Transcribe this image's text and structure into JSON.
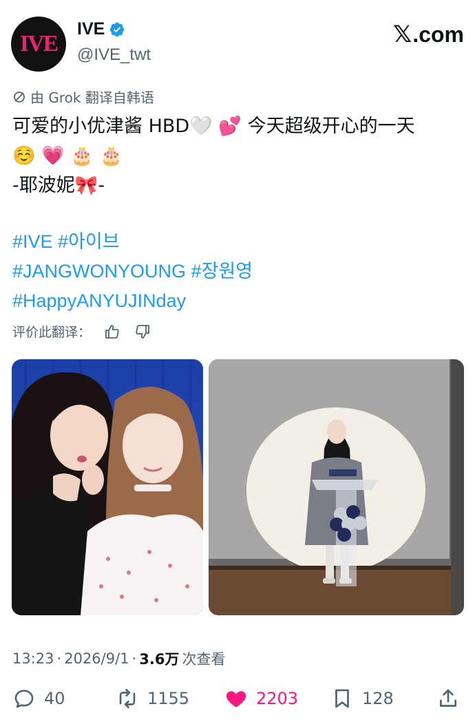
{
  "header": {
    "avatar_logo_text": "IVE",
    "display_name": "IVE",
    "handle": "@IVE_twt",
    "verified_icon": "verified-badge-icon",
    "site_brand": ".com",
    "site_brand_mark": "𝕏"
  },
  "translation": {
    "icon": "no-translate-icon",
    "note": "由 Grok 翻译自韩语"
  },
  "tweet": {
    "line1": "可爱的小优津酱 HBD🤍 💕 今天超级开心的一天",
    "line2": "☺️ 💗 🎂 🎂",
    "line3": "-耶波妮🎀-"
  },
  "hashtags": {
    "line1": [
      "#IVE",
      "#아이브"
    ],
    "line2": [
      "#JANGWONYOUNG",
      "#장원영"
    ],
    "line3": [
      "#HappyANYUJINday"
    ]
  },
  "rating": {
    "label": "评价此翻译：",
    "thumbs_up_icon": "thumbs-up-icon",
    "thumbs_down_icon": "thumbs-down-icon"
  },
  "media": {
    "left": "photo-two-women-selfie",
    "right": "photo-woman-speaking-at-podium"
  },
  "meta": {
    "time": "13:23",
    "sep1": "·",
    "date": "2026/9/1",
    "sep2": "·",
    "views_count": "3.6万",
    "views_label": "次查看"
  },
  "actions": {
    "replies": "40",
    "reposts": "1155",
    "likes": "2203",
    "bookmarks": "128"
  },
  "colors": {
    "accent": "#1d9bf0",
    "like": "#f91880",
    "muted": "#536471",
    "logo": "#e8246f"
  }
}
